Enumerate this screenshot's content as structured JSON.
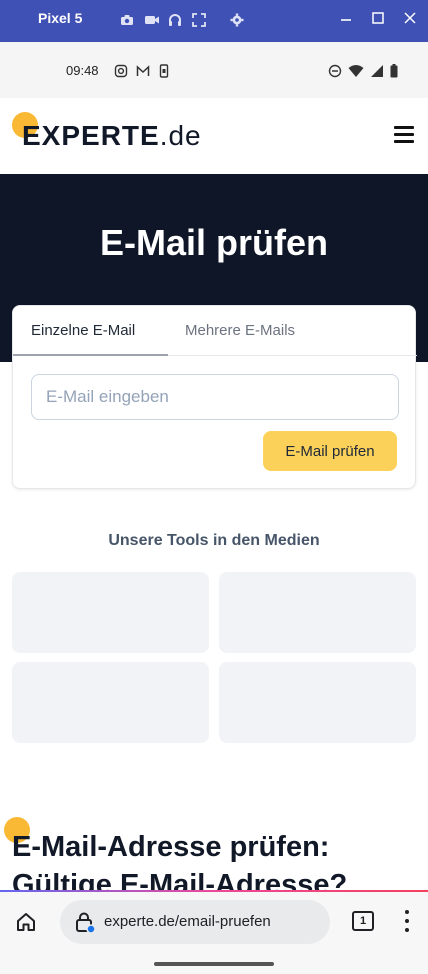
{
  "emulator": {
    "title": "Pixel 5",
    "toolbar_icons": [
      "camera-icon",
      "video-icon",
      "headphones-icon",
      "resize-icon",
      "settings-icon"
    ],
    "window_controls": [
      "minimize-icon",
      "maximize-icon",
      "close-icon"
    ]
  },
  "status_bar": {
    "time": "09:48",
    "left_icons": [
      "instagram-icon",
      "gmail-icon",
      "phone-icon"
    ],
    "right_icons": [
      "dnd-icon",
      "wifi-icon",
      "signal-icon",
      "battery-icon"
    ]
  },
  "header": {
    "logo_main": "EXPERTE",
    "logo_tld": ".de",
    "menu_icon": "hamburger-menu-icon"
  },
  "hero": {
    "title": "E-Mail prüfen"
  },
  "tool": {
    "tabs": [
      {
        "label": "Einzelne E-Mail",
        "active": true
      },
      {
        "label": "Mehrere E-Mails",
        "active": false
      }
    ],
    "input_placeholder": "E-Mail eingeben",
    "input_value": "",
    "button_label": "E-Mail prüfen"
  },
  "media": {
    "title": "Unsere Tools in den Medien"
  },
  "article": {
    "title_line1": "E-Mail-Adresse prüfen:",
    "title_line2": "Gültige E-Mail-Adresse?"
  },
  "browser": {
    "url": "experte.de/email-pruefen",
    "tab_count": "1"
  },
  "colors": {
    "emulator_bar": "#3f51b5",
    "hero_bg": "#0e1627",
    "accent_yellow": "#fcd15a",
    "logo_dot": "#f9b934"
  }
}
